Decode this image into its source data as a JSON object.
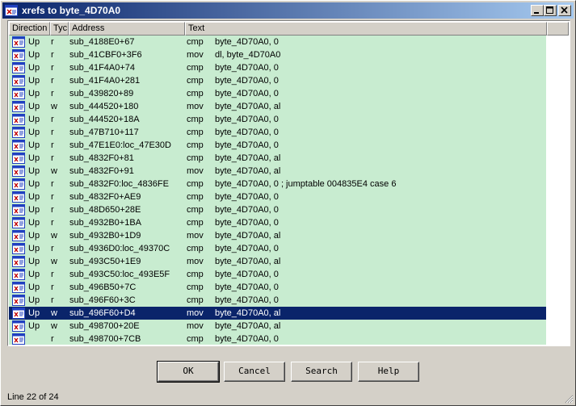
{
  "window": {
    "title": "xrefs to byte_4D70A0"
  },
  "columns": [
    "Direction",
    "Tyc",
    "Address",
    "Text"
  ],
  "rows": [
    {
      "direction": "Up",
      "type": "r",
      "address": "sub_4188E0+67",
      "mnemonic": "cmp",
      "operands": "byte_4D70A0, 0"
    },
    {
      "direction": "Up",
      "type": "r",
      "address": "sub_41CBF0+3F6",
      "mnemonic": "mov",
      "operands": "dl, byte_4D70A0"
    },
    {
      "direction": "Up",
      "type": "r",
      "address": "sub_41F4A0+74",
      "mnemonic": "cmp",
      "operands": "byte_4D70A0, 0"
    },
    {
      "direction": "Up",
      "type": "r",
      "address": "sub_41F4A0+281",
      "mnemonic": "cmp",
      "operands": "byte_4D70A0, 0"
    },
    {
      "direction": "Up",
      "type": "r",
      "address": "sub_439820+89",
      "mnemonic": "cmp",
      "operands": "byte_4D70A0, 0"
    },
    {
      "direction": "Up",
      "type": "w",
      "address": "sub_444520+180",
      "mnemonic": "mov",
      "operands": "byte_4D70A0, al"
    },
    {
      "direction": "Up",
      "type": "r",
      "address": "sub_444520+18A",
      "mnemonic": "cmp",
      "operands": "byte_4D70A0, 0"
    },
    {
      "direction": "Up",
      "type": "r",
      "address": "sub_47B710+117",
      "mnemonic": "cmp",
      "operands": "byte_4D70A0, 0"
    },
    {
      "direction": "Up",
      "type": "r",
      "address": "sub_47E1E0:loc_47E30D",
      "mnemonic": "cmp",
      "operands": "byte_4D70A0, 0"
    },
    {
      "direction": "Up",
      "type": "r",
      "address": "sub_4832F0+81",
      "mnemonic": "cmp",
      "operands": "byte_4D70A0, al"
    },
    {
      "direction": "Up",
      "type": "w",
      "address": "sub_4832F0+91",
      "mnemonic": "mov",
      "operands": "byte_4D70A0, al"
    },
    {
      "direction": "Up",
      "type": "r",
      "address": "sub_4832F0:loc_4836FE",
      "mnemonic": "cmp",
      "operands": "byte_4D70A0, 0  ; jumptable 004835E4 case 6"
    },
    {
      "direction": "Up",
      "type": "r",
      "address": "sub_4832F0+AE9",
      "mnemonic": "cmp",
      "operands": "byte_4D70A0, 0"
    },
    {
      "direction": "Up",
      "type": "r",
      "address": "sub_48D650+28E",
      "mnemonic": "cmp",
      "operands": "byte_4D70A0, 0"
    },
    {
      "direction": "Up",
      "type": "r",
      "address": "sub_4932B0+1BA",
      "mnemonic": "cmp",
      "operands": "byte_4D70A0, 0"
    },
    {
      "direction": "Up",
      "type": "w",
      "address": "sub_4932B0+1D9",
      "mnemonic": "mov",
      "operands": "byte_4D70A0, al"
    },
    {
      "direction": "Up",
      "type": "r",
      "address": "sub_4936D0:loc_49370C",
      "mnemonic": "cmp",
      "operands": "byte_4D70A0, 0"
    },
    {
      "direction": "Up",
      "type": "w",
      "address": "sub_493C50+1E9",
      "mnemonic": "mov",
      "operands": "byte_4D70A0, al"
    },
    {
      "direction": "Up",
      "type": "r",
      "address": "sub_493C50:loc_493E5F",
      "mnemonic": "cmp",
      "operands": "byte_4D70A0, 0"
    },
    {
      "direction": "Up",
      "type": "r",
      "address": "sub_496B50+7C",
      "mnemonic": "cmp",
      "operands": "byte_4D70A0, 0"
    },
    {
      "direction": "Up",
      "type": "r",
      "address": "sub_496F60+3C",
      "mnemonic": "cmp",
      "operands": "byte_4D70A0, 0"
    },
    {
      "direction": "Up",
      "type": "w",
      "address": "sub_496F60+D4",
      "mnemonic": "mov",
      "operands": "byte_4D70A0, al",
      "selected": true
    },
    {
      "direction": "Up",
      "type": "w",
      "address": "sub_498700+20E",
      "mnemonic": "mov",
      "operands": "byte_4D70A0, al"
    },
    {
      "direction": "",
      "type": "r",
      "address": "sub_498700+7CB",
      "mnemonic": "cmp",
      "operands": "byte_4D70A0, 0"
    }
  ],
  "buttons": {
    "ok": "OK",
    "cancel": "Cancel",
    "search": "Search",
    "help": "Help"
  },
  "status": "Line 22 of 24",
  "colors": {
    "row_background": "#c8ecd0",
    "selection": "#0a246a",
    "title_start": "#0a246a",
    "title_end": "#a6caf0"
  }
}
